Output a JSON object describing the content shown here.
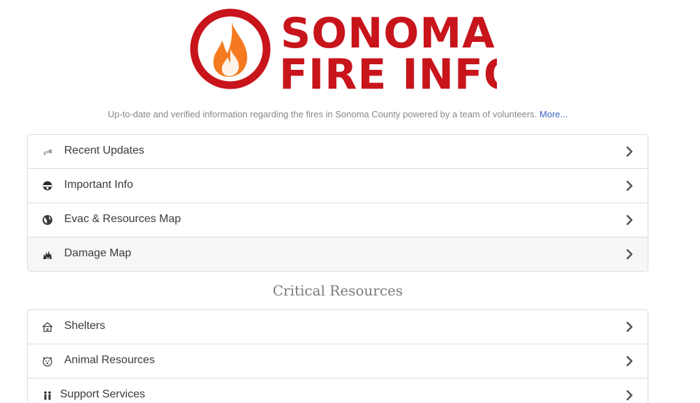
{
  "brand": {
    "line1": "SONOMA",
    "line2": "FIRE INFO",
    "color": "#c8141b",
    "flame_color": "#f57a1f"
  },
  "tagline": {
    "text": "Up-to-date and verified information regarding the fires in Sonoma County powered by a team of volunteers.",
    "link": "More..."
  },
  "main_menu": [
    {
      "label": "Recent Updates",
      "icon": "megaphone-icon"
    },
    {
      "label": "Important Info",
      "icon": "helmet-icon"
    },
    {
      "label": "Evac & Resources Map",
      "icon": "globe-icon"
    },
    {
      "label": "Damage Map",
      "icon": "fire-icon"
    }
  ],
  "critical": {
    "heading": "Critical Resources",
    "items": [
      {
        "label": "Shelters",
        "icon": "house-icon"
      },
      {
        "label": "Animal Resources",
        "icon": "dog-icon"
      },
      {
        "label": "Support Services",
        "icon": "people-icon"
      }
    ]
  }
}
